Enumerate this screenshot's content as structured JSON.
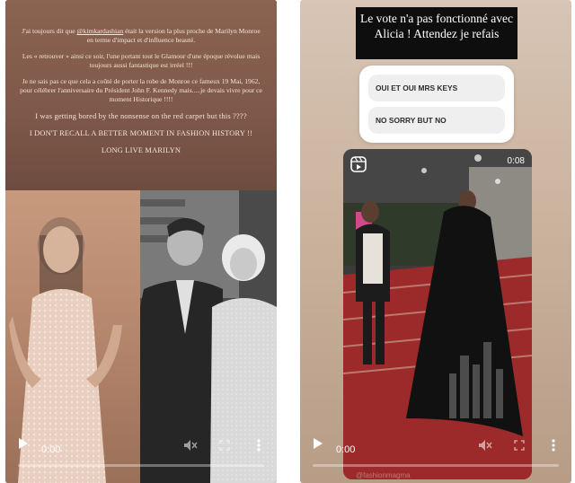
{
  "left_story": {
    "caption": {
      "p1_prefix": "J'ai toujours dit que ",
      "p1_mention": "@kimkardashian",
      "p1_suffix": " était la version la plus proche de Marilyn Monroe en terme d'impact et d'influence beauté.",
      "p2": "Les « retrouver » ainsi ce soir, l'une portant tout le Glamour d'une époque révolue mais toujours aussi fantastique est irréel !!!",
      "p3": "Je ne sais pas ce que cela a coûté de porter la robe de Monroe ce fameux 19 Mai, 1962, pour célébrer l'anniversaire du Président John F. Kennedy mais.....je devais vivre pour ce moment Historique !!!!",
      "p4": "I was getting bored by the nonsense on the red carpet but this ????",
      "p5": "I DON'T RECALL A BETTER MOMENT IN FASHION HISTORY !!",
      "p6": "LONG LIVE MARILYN"
    },
    "video": {
      "time": "0:00",
      "progress": 0
    }
  },
  "right_story": {
    "banner": "Le vote n'a pas fonctionné avec Alicia ! Attendez je refais",
    "poll": {
      "options": [
        "OUI ET OUI MRS KEYS",
        "NO SORRY BUT NO"
      ]
    },
    "video": {
      "timer": "0:08",
      "time": "0:00",
      "progress": 0,
      "watermark": "@fashionmagma"
    }
  },
  "icons": [
    "play-icon",
    "mute-icon",
    "fullscreen-icon",
    "more-icon",
    "reel-icon"
  ],
  "colors": {
    "text_card_bg": "#7e5849",
    "caption_text": "#f3e5d8",
    "banner_bg": "#0e0e0e",
    "poll_option_bg": "#efefef",
    "carpet_red": "#9c2a2a"
  }
}
